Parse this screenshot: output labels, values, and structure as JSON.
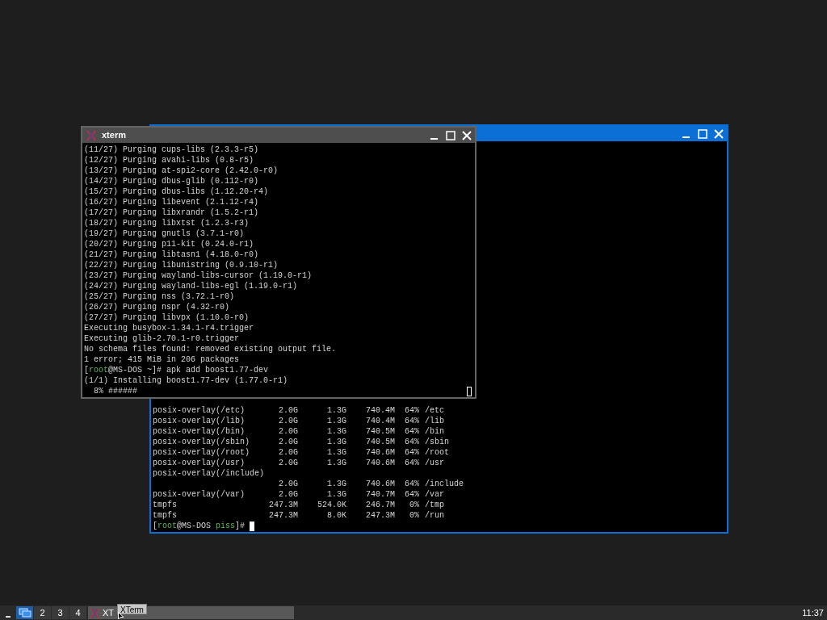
{
  "windows": [
    {
      "kind": "df",
      "active": true,
      "rows": [
        {
          "kind": "normal",
          "filesystem": "posix-overlay(/etc)",
          "size": "2.0G",
          "used": "1.3G",
          "avail": "740.4M",
          "use": "64%",
          "mounted": "/etc"
        },
        {
          "kind": "normal",
          "filesystem": "posix-overlay(/lib)",
          "size": "2.0G",
          "used": "1.3G",
          "avail": "740.4M",
          "use": "64%",
          "mounted": "/lib"
        },
        {
          "kind": "normal",
          "filesystem": "posix-overlay(/bin)",
          "size": "2.0G",
          "used": "1.3G",
          "avail": "740.5M",
          "use": "64%",
          "mounted": "/bin"
        },
        {
          "kind": "normal",
          "filesystem": "posix-overlay(/sbin)",
          "size": "2.0G",
          "used": "1.3G",
          "avail": "740.5M",
          "use": "64%",
          "mounted": "/sbin"
        },
        {
          "kind": "normal",
          "filesystem": "posix-overlay(/root)",
          "size": "2.0G",
          "used": "1.3G",
          "avail": "740.6M",
          "use": "64%",
          "mounted": "/root"
        },
        {
          "kind": "normal",
          "filesystem": "posix-overlay(/usr)",
          "size": "2.0G",
          "used": "1.3G",
          "avail": "740.6M",
          "use": "64%",
          "mounted": "/usr"
        },
        {
          "kind": "wrapped",
          "filesystem": "posix-overlay(/include)",
          "size": "2.0G",
          "used": "1.3G",
          "avail": "740.6M",
          "use": "64%",
          "mounted": "/include"
        },
        {
          "kind": "normal",
          "filesystem": "posix-overlay(/var)",
          "size": "2.0G",
          "used": "1.3G",
          "avail": "740.7M",
          "use": "64%",
          "mounted": "/var"
        },
        {
          "kind": "normal",
          "filesystem": "tmpfs",
          "size": "247.3M",
          "used": "524.0K",
          "avail": "246.7M",
          "use": "0%",
          "mounted": "/tmp"
        },
        {
          "kind": "normal",
          "filesystem": "tmpfs",
          "size": "247.3M",
          "used": "8.0K",
          "avail": "247.3M",
          "use": "0%",
          "mounted": "/run"
        }
      ],
      "prompt": [
        {
          "text": "[",
          "highlight": false
        },
        {
          "text": "root",
          "highlight": true
        },
        {
          "text": "@MS-DOS ",
          "highlight": false
        },
        {
          "text": "piss",
          "highlight": true
        },
        {
          "text": "]# ",
          "highlight": false
        }
      ]
    },
    {
      "kind": "log",
      "active": false,
      "title": "xterm",
      "lines": [
        [
          {
            "text": "(11/27) Purging cups-libs (2.3.3-r5)",
            "highlight": false
          }
        ],
        [
          {
            "text": "(12/27) Purging avahi-libs (0.8-r5)",
            "highlight": false
          }
        ],
        [
          {
            "text": "(13/27) Purging at-spi2-core (2.42.0-r0)",
            "highlight": false
          }
        ],
        [
          {
            "text": "(14/27) Purging dbus-glib (0.112-r0)",
            "highlight": false
          }
        ],
        [
          {
            "text": "(15/27) Purging dbus-libs (1.12.20-r4)",
            "highlight": false
          }
        ],
        [
          {
            "text": "(16/27) Purging libevent (2.1.12-r4)",
            "highlight": false
          }
        ],
        [
          {
            "text": "(17/27) Purging libxrandr (1.5.2-r1)",
            "highlight": false
          }
        ],
        [
          {
            "text": "(18/27) Purging libxtst (1.2.3-r3)",
            "highlight": false
          }
        ],
        [
          {
            "text": "(19/27) Purging gnutls (3.7.1-r0)",
            "highlight": false
          }
        ],
        [
          {
            "text": "(20/27) Purging p11-kit (0.24.0-r1)",
            "highlight": false
          }
        ],
        [
          {
            "text": "(21/27) Purging libtasn1 (4.18.0-r0)",
            "highlight": false
          }
        ],
        [
          {
            "text": "(22/27) Purging libunistring (0.9.10-r1)",
            "highlight": false
          }
        ],
        [
          {
            "text": "(23/27) Purging wayland-libs-cursor (1.19.0-r1)",
            "highlight": false
          }
        ],
        [
          {
            "text": "(24/27) Purging wayland-libs-egl (1.19.0-r1)",
            "highlight": false
          }
        ],
        [
          {
            "text": "(25/27) Purging nss (3.72.1-r0)",
            "highlight": false
          }
        ],
        [
          {
            "text": "(26/27) Purging nspr (4.32-r0)",
            "highlight": false
          }
        ],
        [
          {
            "text": "(27/27) Purging libvpx (1.10.0-r0)",
            "highlight": false
          }
        ],
        [
          {
            "text": "Executing busybox-1.34.1-r4.trigger",
            "highlight": false
          }
        ],
        [
          {
            "text": "Executing glib-2.70.1-r0.trigger",
            "highlight": false
          }
        ],
        [
          {
            "text": "No schema files found: removed existing output file.",
            "highlight": false
          }
        ],
        [
          {
            "text": "1 error; 415 MiB in 206 packages",
            "highlight": false
          }
        ],
        [
          {
            "text": "[",
            "highlight": false
          },
          {
            "text": "root",
            "highlight": true
          },
          {
            "text": "@MS-DOS ~]# apk add boost1.77-dev",
            "highlight": false
          }
        ],
        [
          {
            "text": "(1/1) Installing boost1.77-dev (1.77.0-r1)",
            "highlight": false
          }
        ],
        [
          {
            "text": "  8% ######",
            "highlight": false
          }
        ]
      ]
    }
  ],
  "taskbar": {
    "workspaces": [
      {
        "kind": "icon",
        "selected": true
      },
      {
        "kind": "number",
        "label": "2",
        "selected": false
      },
      {
        "kind": "number",
        "label": "3",
        "selected": false
      },
      {
        "kind": "number",
        "label": "4",
        "selected": false
      }
    ],
    "task": {
      "label": "XT"
    },
    "tooltip": "XTerm",
    "clock": "11:37"
  }
}
